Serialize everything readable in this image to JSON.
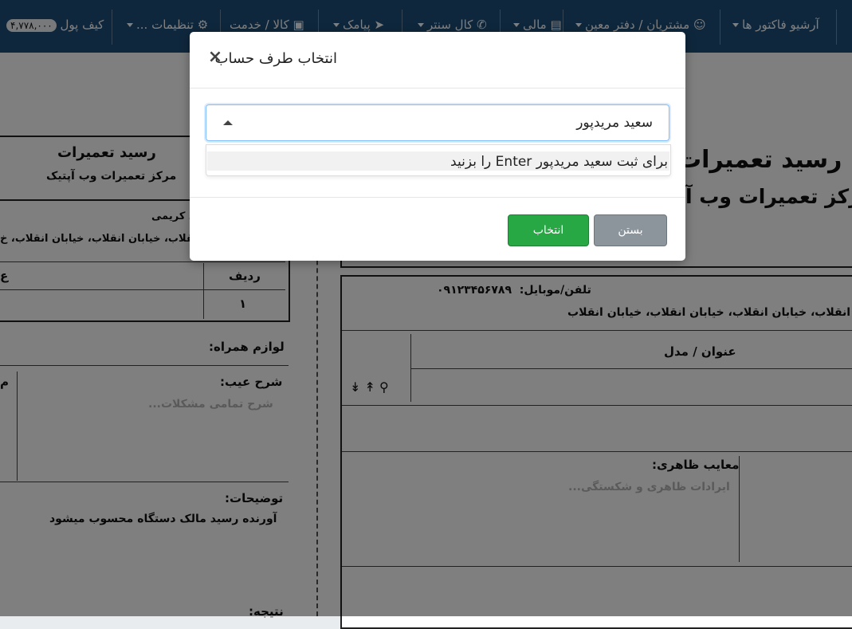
{
  "navbar": {
    "items": [
      {
        "label": "آرشیو فاکتور ها"
      },
      {
        "label": "مشتریان / دفتر معین"
      },
      {
        "label": "مالی"
      },
      {
        "label": "کال سنتر"
      },
      {
        "label": "پیامک"
      },
      {
        "label": "کالا / خدمت"
      },
      {
        "label": "تنظیمات ..."
      },
      {
        "label": "کیف پول",
        "amount": "۴,۷۷۸,۰۰۰"
      }
    ]
  },
  "receipt_right": {
    "title": "رسید تعمیرات",
    "subtitle": "مرکز تعمیرات وب آ",
    "phone_label": "تلفن/موبایل:",
    "phone_value": "۰۹۱۲۳۴۵۶۷۸۹",
    "address": "ی انقلاب، خیابان انقلاب، خیابان انقلاب، خیابان انقلاب",
    "col_title": "عنوان / مدل",
    "defects_label": "معایب ظاهری:",
    "defects_placeholder": "ایرادات ظاهری و شکستگی..."
  },
  "receipt_left": {
    "title": "رسید تعمیرات",
    "subtitle": "مرکز تعمیرات وب آپتیک",
    "customer": "د کریمی",
    "address": "ن انقلاب، خیابان انقلاب، خیابان انقلاب، خ",
    "col_row": "ردیف",
    "col_other": "ع",
    "row_number": "۱",
    "accessories_label": "لوازم همراه:",
    "fault_label": "شرح عیب:",
    "fault_placeholder": "شرح تمامی مشکلات...",
    "notes_label": "توضیحات:",
    "notes_value": "آورنده رسید مالک دستگاه محسوب میشود",
    "result_label": "نتیجه:",
    "side_m": "م"
  },
  "modal": {
    "title": "انتخاب طرف حساب",
    "select_value": "سعید مریدپور",
    "option_text": "برای ثبت سعید مریدپور Enter را بزنید",
    "close_label": "بستن",
    "select_label": "انتخاب"
  }
}
